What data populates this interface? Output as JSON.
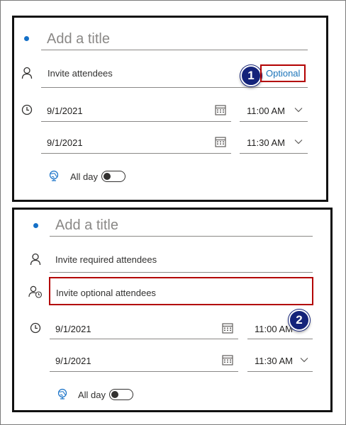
{
  "panel1": {
    "title_placeholder": "Add a title",
    "attendees_placeholder": "Invite attendees",
    "optional_link": "Optional",
    "start_date": "9/1/2021",
    "start_time": "11:00 AM",
    "end_date": "9/1/2021",
    "end_time": "11:30 AM",
    "allday_label": "All day",
    "step_badge": "1"
  },
  "panel2": {
    "title_placeholder": "Add a title",
    "required_placeholder": "Invite required attendees",
    "optional_placeholder": "Invite optional attendees",
    "start_date": "9/1/2021",
    "start_time": "11:00 AM",
    "end_date": "9/1/2021",
    "end_time": "11:30 AM",
    "allday_label": "All day",
    "step_badge": "2"
  },
  "icons": {
    "person": "person-icon",
    "person_optional": "optional-person-icon",
    "clock": "clock-icon",
    "calendar": "calendar-icon",
    "chevron": "chevron-down-icon",
    "globe": "globe-icon"
  },
  "colors": {
    "accent_blue": "#1570c7",
    "highlight_red": "#b30000",
    "badge_navy": "#14237a"
  },
  "allday_toggle_on": false
}
